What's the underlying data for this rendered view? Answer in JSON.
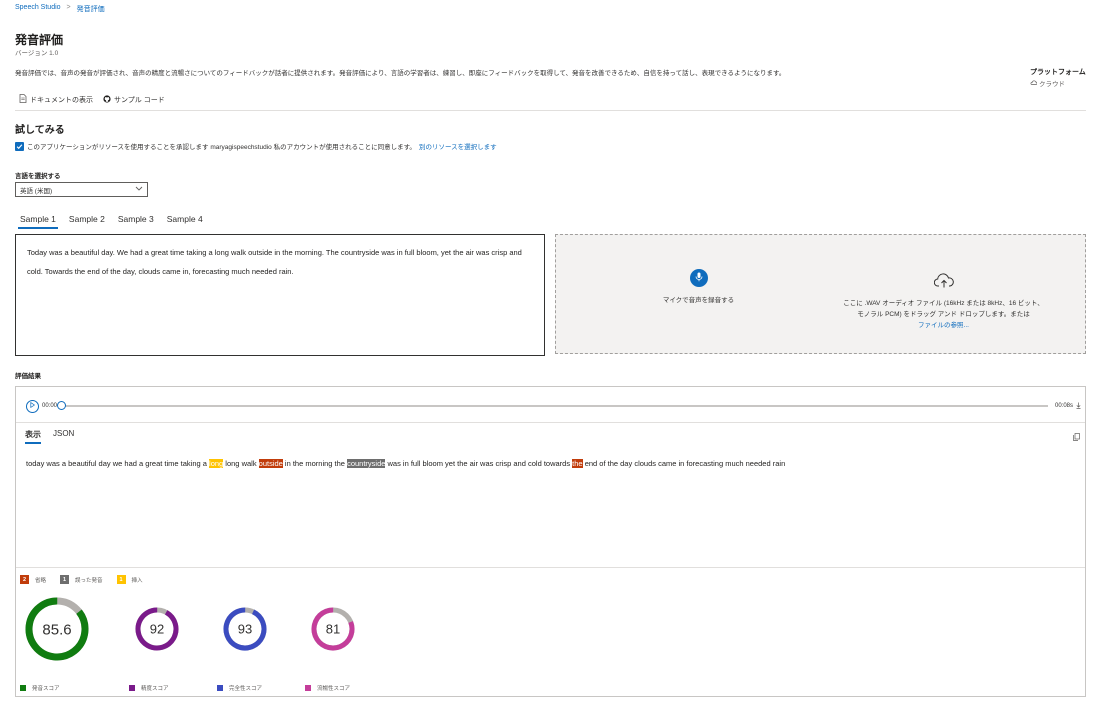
{
  "breadcrumb": {
    "root": "Speech Studio",
    "current": "発音評価"
  },
  "page": {
    "title": "発音評価",
    "version": "バージョン 1.0",
    "description": "発音評価では、音声の発音が評価され、音声の精度と流暢さについてのフィードバックが話者に提供されます。発音評価により、言語の学習者は、練習し、即座にフィードバックを取得して、発音を改善できるため、自信を持って話し、表現できるようになります。",
    "platform_label": "プラットフォーム",
    "platform_value": "クラウド",
    "docs_link": "ドキュメントの表示",
    "sample_code_link": "サンプル コード"
  },
  "tryit": {
    "title": "試してみる",
    "consent_text": "このアプリケーションがリソースを使用することを承認します maryagispeechstudio 私のアカウントが使用されることに同意します。",
    "consent_link": "別のリソースを選択します",
    "language_label": "言語を選択する",
    "language_value": "英語 (米国)"
  },
  "samples": {
    "tabs": [
      "Sample 1",
      "Sample 2",
      "Sample 3",
      "Sample 4"
    ],
    "active_index": 0,
    "text": "Today was a beautiful day. We had a great time taking a long walk outside in the morning. The countryside was in full bloom, yet the air was crisp and cold. Towards the end of the day, clouds came in, forecasting much needed rain."
  },
  "dropzone": {
    "mic_label": "マイクで音声を録音する",
    "upload_line1": "ここに .WAV オーディオ ファイル (16kHz または 8kHz、16 ビット、",
    "upload_line2": "モノラル PCM) をドラッグ アンド ドロップします。または",
    "browse_link": "ファイルの参照..."
  },
  "results": {
    "label": "評価結果",
    "time_start": "00:00",
    "time_end": "00:08s",
    "playback_progress": 0,
    "tabs": [
      "表示",
      "JSON"
    ],
    "active_tab": 0,
    "transcript": [
      {
        "text": "today was a beautiful day we had a great time taking a ",
        "type": "normal"
      },
      {
        "text": "long",
        "type": "insertion"
      },
      {
        "text": " long walk ",
        "type": "normal"
      },
      {
        "text": "outside",
        "type": "omission"
      },
      {
        "text": " in the morning the ",
        "type": "normal"
      },
      {
        "text": "countryside",
        "type": "mispronunciation"
      },
      {
        "text": " was in full bloom yet the air was crisp and cold towards ",
        "type": "normal"
      },
      {
        "text": "the",
        "type": "omission"
      },
      {
        "text": " end of the day clouds came in forecasting much needed rain",
        "type": "normal"
      }
    ],
    "legend": [
      {
        "count": "2",
        "label": "省略",
        "color": "#c13c0b"
      },
      {
        "count": "1",
        "label": "誤った発音",
        "color": "#6e6e6e"
      },
      {
        "count": "1",
        "label": "挿入",
        "color": "#ffc300"
      }
    ],
    "scores": [
      {
        "value": "85.6",
        "fraction": 0.856,
        "label": "発音スコア",
        "color": "#107c10"
      },
      {
        "value": "92",
        "fraction": 0.92,
        "label": "精度スコア",
        "color": "#7a1a8a"
      },
      {
        "value": "93",
        "fraction": 0.93,
        "label": "完全性スコア",
        "color": "#3b4cc0"
      },
      {
        "value": "81",
        "fraction": 0.81,
        "label": "流暢性スコア",
        "color": "#c43d9a"
      }
    ]
  }
}
